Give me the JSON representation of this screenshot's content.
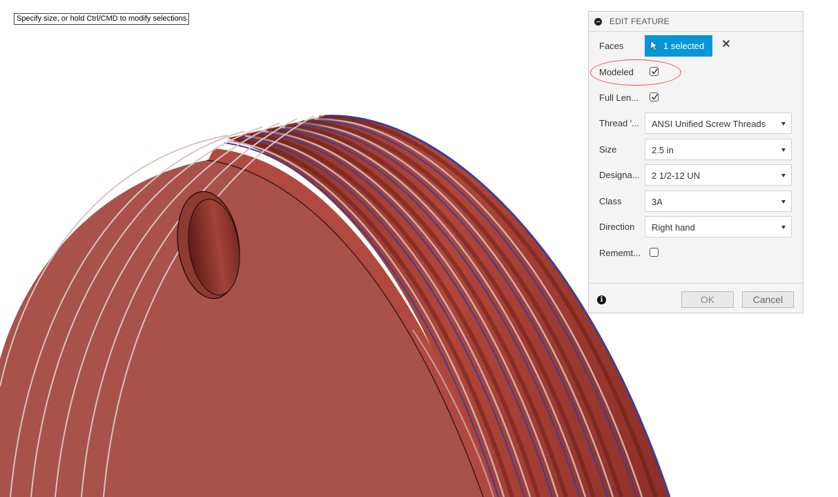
{
  "status": {
    "hint": "Specify size, or hold Ctrl/CMD to modify selections"
  },
  "panel": {
    "title": "EDIT FEATURE",
    "rows": {
      "faces": {
        "label": "Faces",
        "value": "1 selected"
      },
      "modeled": {
        "label": "Modeled",
        "checked": true
      },
      "full_length": {
        "label": "Full Len...",
        "checked": true
      },
      "thread_type": {
        "label": "Thread '...",
        "value": "ANSI Unified Screw Threads"
      },
      "size": {
        "label": "Size",
        "value": "2.5 in"
      },
      "designation": {
        "label": "Designa...",
        "value": "2 1/2-12 UN"
      },
      "class": {
        "label": "Class",
        "value": "3A"
      },
      "direction": {
        "label": "Direction",
        "value": "Right hand"
      },
      "remember": {
        "label": "Rememt...",
        "checked": false
      }
    },
    "buttons": {
      "ok": "OK",
      "cancel": "Cancel"
    }
  },
  "colors": {
    "accent": "#0696d7",
    "model_face": "#a8524a",
    "highlight": "#e05050"
  }
}
